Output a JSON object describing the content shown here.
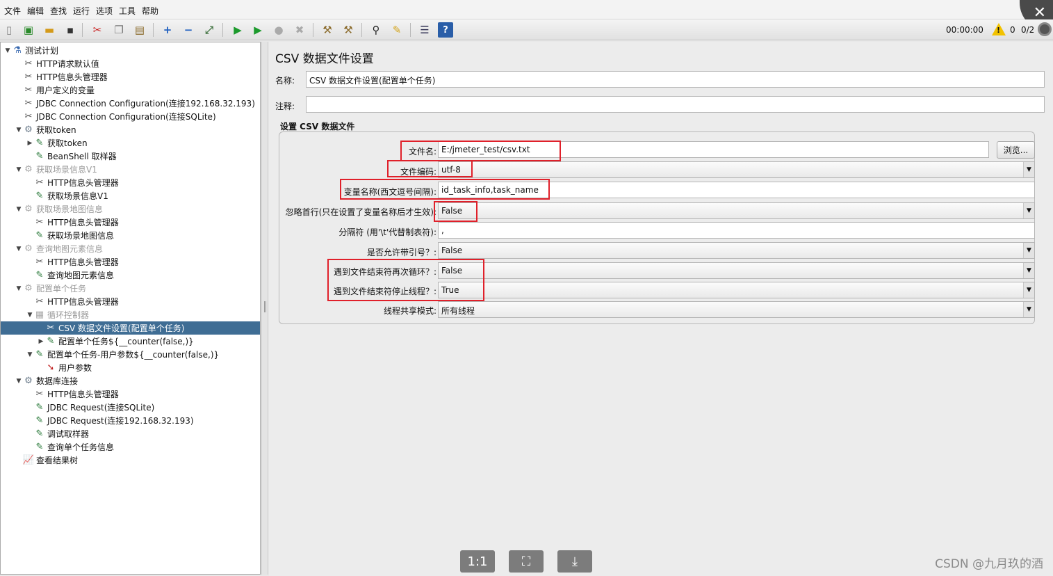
{
  "menu": [
    "文件",
    "编辑",
    "查找",
    "运行",
    "选项",
    "工具",
    "帮助"
  ],
  "toolbar": {
    "icons": [
      "new-icon",
      "templates-icon",
      "open-icon",
      "save-icon",
      "cut-icon",
      "copy-icon",
      "paste-icon",
      "expand-icon",
      "collapse-icon",
      "toggle-icon",
      "start-icon",
      "start-no-pause-icon",
      "stop-icon",
      "shutdown-icon",
      "clear-icon",
      "clear-all-icon",
      "search-icon",
      "reset-search-icon",
      "function-helper-icon",
      "help-icon"
    ],
    "timer": "00:00:00",
    "warning_count": "0",
    "thread_count": "0/2"
  },
  "tree": [
    {
      "label": "测试计划",
      "level": 0,
      "toggle": "▼",
      "icon": "test-plan-icon",
      "glyph": "⚗",
      "disabled": false
    },
    {
      "label": "HTTP请求默认值",
      "level": 1,
      "toggle": "",
      "icon": "config-icon",
      "glyph": "✂",
      "disabled": false
    },
    {
      "label": "HTTP信息头管理器",
      "level": 1,
      "toggle": "",
      "icon": "config-icon",
      "glyph": "✂",
      "disabled": false
    },
    {
      "label": "用户定义的变量",
      "level": 1,
      "toggle": "",
      "icon": "config-icon",
      "glyph": "✂",
      "disabled": false
    },
    {
      "label": "JDBC Connection Configuration(连接192.168.32.193)",
      "level": 1,
      "toggle": "",
      "icon": "config-icon",
      "glyph": "✂",
      "disabled": false
    },
    {
      "label": "JDBC Connection Configuration(连接SQLite)",
      "level": 1,
      "toggle": "",
      "icon": "config-icon",
      "glyph": "✂",
      "disabled": false
    },
    {
      "label": "获取token",
      "level": 1,
      "toggle": "▼",
      "icon": "thread-group-icon",
      "glyph": "⚙",
      "disabled": false
    },
    {
      "label": "获取token",
      "level": 2,
      "toggle": "▶",
      "icon": "sampler-icon",
      "glyph": "✎",
      "disabled": false
    },
    {
      "label": "BeanShell 取样器",
      "level": 2,
      "toggle": "",
      "icon": "sampler-icon",
      "glyph": "✎",
      "disabled": false
    },
    {
      "label": "获取场景信息V1",
      "level": 1,
      "toggle": "▼",
      "icon": "thread-group-icon",
      "glyph": "⚙",
      "disabled": true
    },
    {
      "label": "HTTP信息头管理器",
      "level": 2,
      "toggle": "",
      "icon": "config-icon",
      "glyph": "✂",
      "disabled": false
    },
    {
      "label": "获取场景信息V1",
      "level": 2,
      "toggle": "",
      "icon": "sampler-icon",
      "glyph": "✎",
      "disabled": false
    },
    {
      "label": "获取场景地图信息",
      "level": 1,
      "toggle": "▼",
      "icon": "thread-group-icon",
      "glyph": "⚙",
      "disabled": true
    },
    {
      "label": "HTTP信息头管理器",
      "level": 2,
      "toggle": "",
      "icon": "config-icon",
      "glyph": "✂",
      "disabled": false
    },
    {
      "label": "获取场景地图信息",
      "level": 2,
      "toggle": "",
      "icon": "sampler-icon",
      "glyph": "✎",
      "disabled": false
    },
    {
      "label": "查询地图元素信息",
      "level": 1,
      "toggle": "▼",
      "icon": "thread-group-icon",
      "glyph": "⚙",
      "disabled": true
    },
    {
      "label": "HTTP信息头管理器",
      "level": 2,
      "toggle": "",
      "icon": "config-icon",
      "glyph": "✂",
      "disabled": false
    },
    {
      "label": "查询地图元素信息",
      "level": 2,
      "toggle": "",
      "icon": "sampler-icon",
      "glyph": "✎",
      "disabled": false
    },
    {
      "label": "配置单个任务",
      "level": 1,
      "toggle": "▼",
      "icon": "thread-group-icon",
      "glyph": "⚙",
      "disabled": true
    },
    {
      "label": "HTTP信息头管理器",
      "level": 2,
      "toggle": "",
      "icon": "config-icon",
      "glyph": "✂",
      "disabled": false
    },
    {
      "label": "循环控制器",
      "level": 2,
      "toggle": "▼",
      "icon": "loop-controller-icon",
      "glyph": "▦",
      "disabled": true
    },
    {
      "label": "CSV 数据文件设置(配置单个任务)",
      "level": 3,
      "toggle": "",
      "icon": "config-icon",
      "glyph": "✂",
      "disabled": false,
      "selected": true
    },
    {
      "label": "配置单个任务${__counter(false,)}",
      "level": 3,
      "toggle": "▶",
      "icon": "sampler-icon",
      "glyph": "✎",
      "disabled": false
    },
    {
      "label": "配置单个任务-用户参数${__counter(false,)}",
      "level": 2,
      "toggle": "▼",
      "icon": "sampler-icon",
      "glyph": "✎",
      "disabled": false
    },
    {
      "label": "用户参数",
      "level": 3,
      "toggle": "",
      "icon": "preprocessor-icon",
      "glyph": "➘",
      "disabled": false
    },
    {
      "label": "数据库连接",
      "level": 1,
      "toggle": "▼",
      "icon": "thread-group-icon",
      "glyph": "⚙",
      "disabled": false
    },
    {
      "label": "HTTP信息头管理器",
      "level": 2,
      "toggle": "",
      "icon": "config-icon",
      "glyph": "✂",
      "disabled": false
    },
    {
      "label": "JDBC Request(连接SQLite)",
      "level": 2,
      "toggle": "",
      "icon": "sampler-icon",
      "glyph": "✎",
      "disabled": false
    },
    {
      "label": "JDBC Request(连接192.168.32.193)",
      "level": 2,
      "toggle": "",
      "icon": "sampler-icon",
      "glyph": "✎",
      "disabled": false
    },
    {
      "label": "调试取样器",
      "level": 2,
      "toggle": "",
      "icon": "sampler-icon",
      "glyph": "✎",
      "disabled": false
    },
    {
      "label": "查询单个任务信息",
      "level": 2,
      "toggle": "",
      "icon": "sampler-icon",
      "glyph": "✎",
      "disabled": false
    },
    {
      "label": "查看结果树",
      "level": 1,
      "toggle": "",
      "icon": "listener-icon",
      "glyph": "📈",
      "disabled": false
    }
  ],
  "form": {
    "title": "CSV 数据文件设置",
    "name_label": "名称:",
    "name_value": "CSV 数据文件设置(配置单个任务)",
    "comment_label": "注释:",
    "comment_value": "",
    "section_title": "设置 CSV 数据文件",
    "filename_label": "文件名:",
    "filename_value": "E:/jmeter_test/csv.txt",
    "browse_label": "浏览...",
    "encoding_label": "文件编码:",
    "encoding_value": "utf-8",
    "varnames_label": "变量名称(西文逗号间隔):",
    "varnames_value": "id_task_info,task_name",
    "ignore_first_label": "忽略首行(只在设置了变量名称后才生效):",
    "ignore_first_value": "False",
    "delimiter_label": "分隔符 (用'\\t'代替制表符):",
    "delimiter_value": ",",
    "quoted_label": "是否允许带引号？:",
    "quoted_value": "False",
    "recycle_label": "遇到文件结束符再次循环？:",
    "recycle_value": "False",
    "stop_thread_label": "遇到文件结束符停止线程？:",
    "stop_thread_value": "True",
    "share_mode_label": "线程共享模式:",
    "share_mode_value": "所有线程"
  },
  "viewer_buttons": [
    "1:1",
    "⛶",
    "⤓"
  ],
  "watermark": "CSDN @九月玖的酒",
  "colors": {
    "highlight_box": "#e0202a",
    "selected_row": "#3f6d94"
  }
}
